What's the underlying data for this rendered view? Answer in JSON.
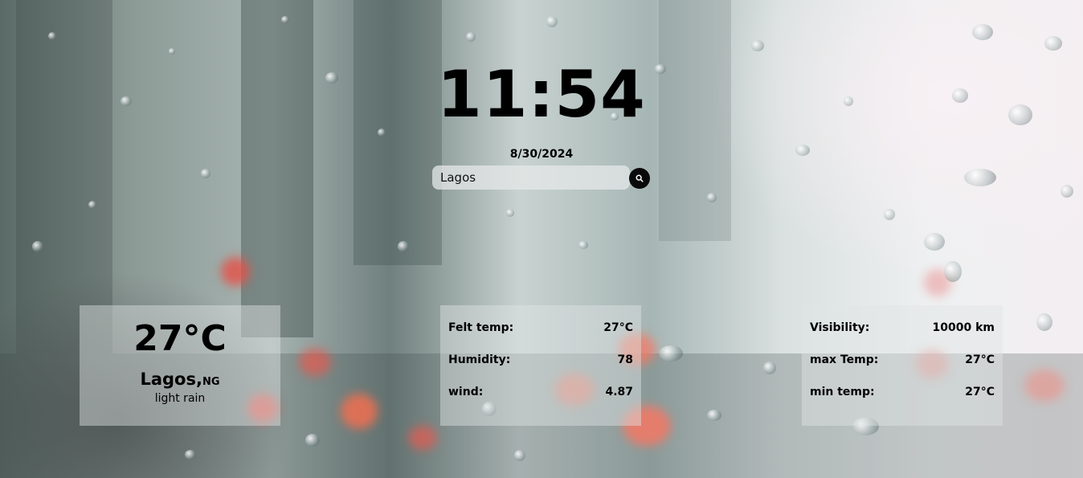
{
  "clock": {
    "time": "11:54",
    "date": "8/30/2024"
  },
  "search": {
    "value": "Lagos",
    "icon": "search-icon"
  },
  "current": {
    "temperature": "27°C",
    "city": "Lagos,",
    "country": "NG",
    "description": "light rain"
  },
  "details_left": [
    {
      "label": "Felt temp:",
      "value": "27°C"
    },
    {
      "label": "Humidity:",
      "value": "78"
    },
    {
      "label": "wind:",
      "value": "4.87"
    }
  ],
  "details_right": [
    {
      "label": "Visibility:",
      "value": "10000 km"
    },
    {
      "label": "max Temp:",
      "value": "27°C"
    },
    {
      "label": "min temp:",
      "value": "27°C"
    }
  ]
}
